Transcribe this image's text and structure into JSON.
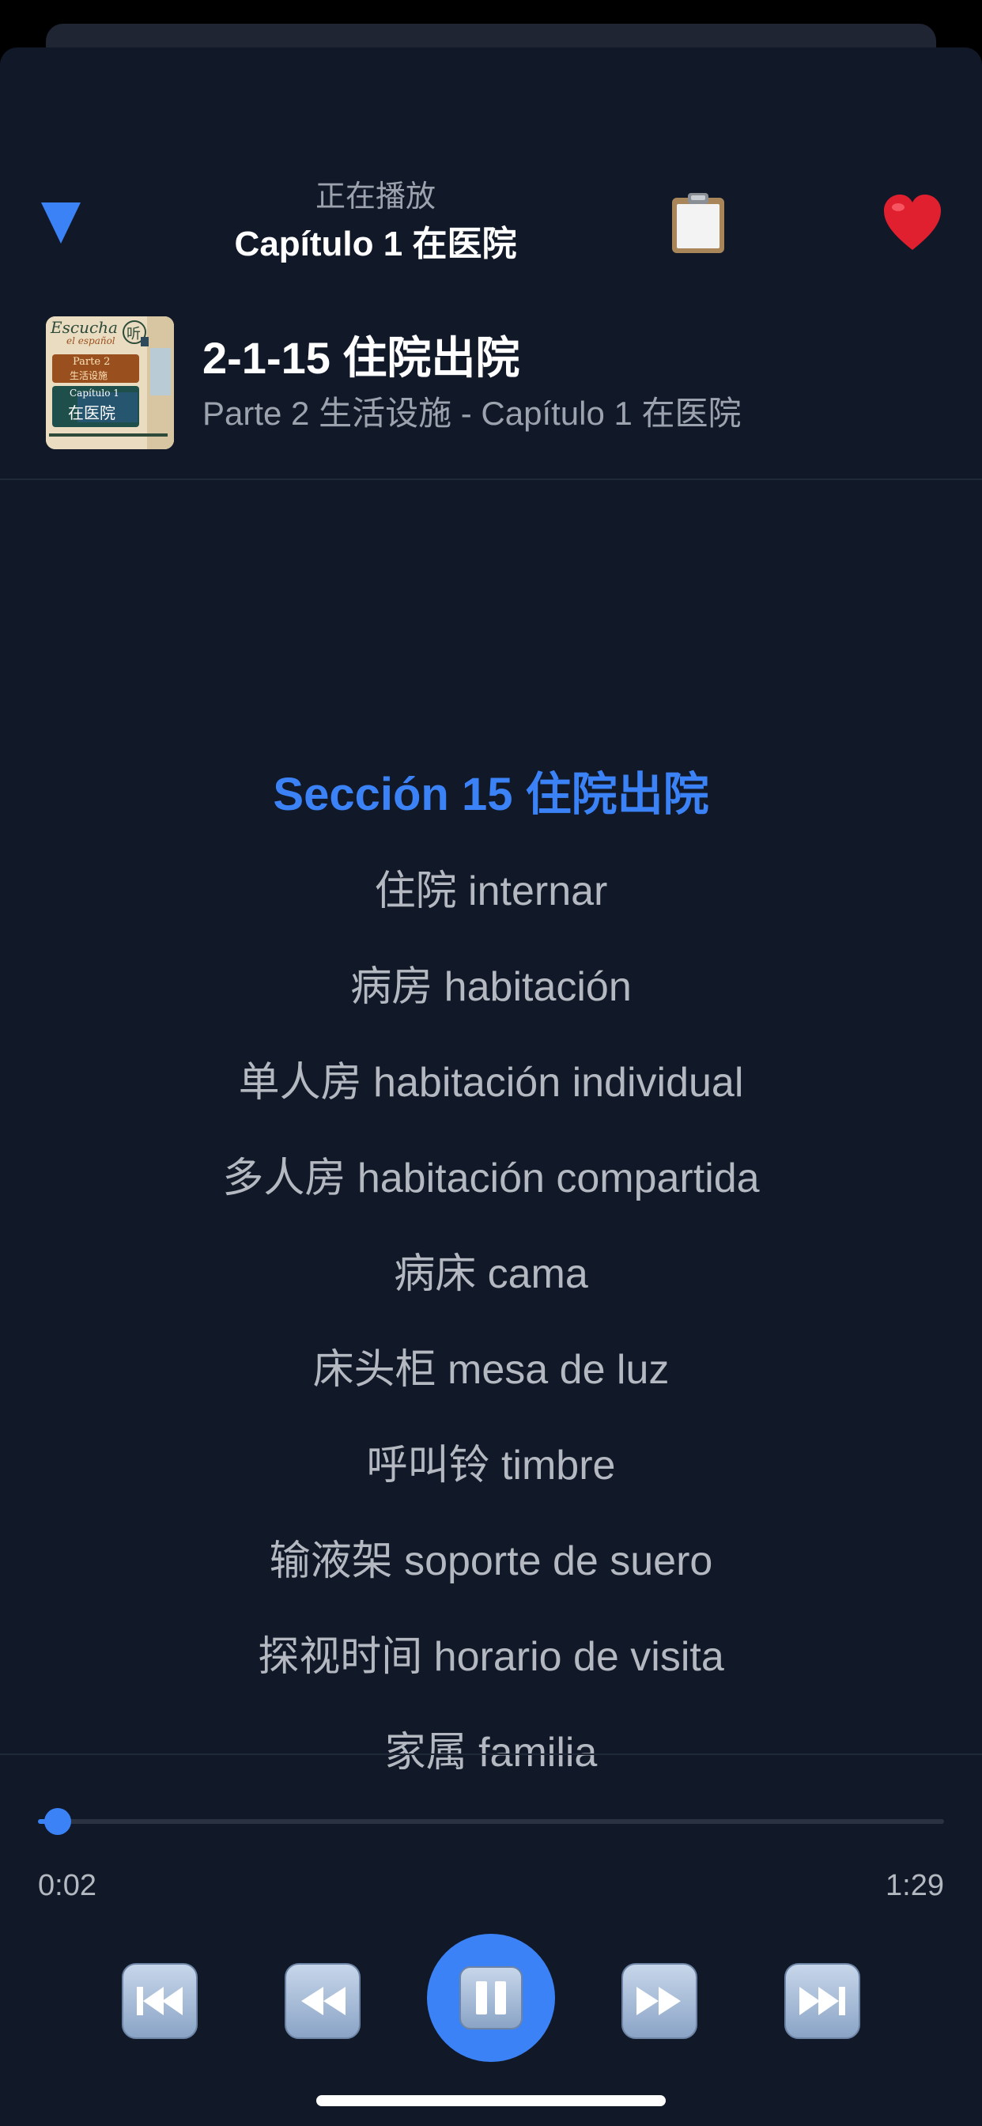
{
  "header": {
    "subtitle": "正在播放",
    "title": "Capítulo 1 在医院",
    "collapse_icon": "triangle-down-icon",
    "playlist_icon": "clipboard-icon",
    "favorite_icon": "heart-icon"
  },
  "track": {
    "title": "2-1-15 住院出院",
    "subtitle": "Parte 2 生活设施 - Capítulo 1 在医院",
    "cover": {
      "line1": "Escucha",
      "line2": "el español",
      "badge": "听",
      "part": "Parte 2",
      "part_cn": "生活设施",
      "chapter": "Capítulo 1",
      "chapter_cn": "在医院"
    }
  },
  "lyrics": {
    "active": "Sección 15 住院出院",
    "lines": [
      "住院 internar",
      "病房 habitación",
      "单人房 habitación individual",
      "多人房 habitación compartida",
      "病床 cama",
      "床头柜 mesa de luz",
      "呼叫铃 timbre",
      "输液架 soporte de suero",
      "探视时间 horario de visita",
      "家属 familia"
    ]
  },
  "player": {
    "elapsed": "0:02",
    "total": "1:29",
    "progress": 0.022,
    "state": "playing",
    "controls": [
      "skip-back-icon",
      "rewind-icon",
      "pause-icon",
      "fast-forward-icon",
      "skip-forward-icon"
    ]
  },
  "colors": {
    "accent": "#3b82f6",
    "background": "#111827",
    "heart": "#e0202f"
  }
}
